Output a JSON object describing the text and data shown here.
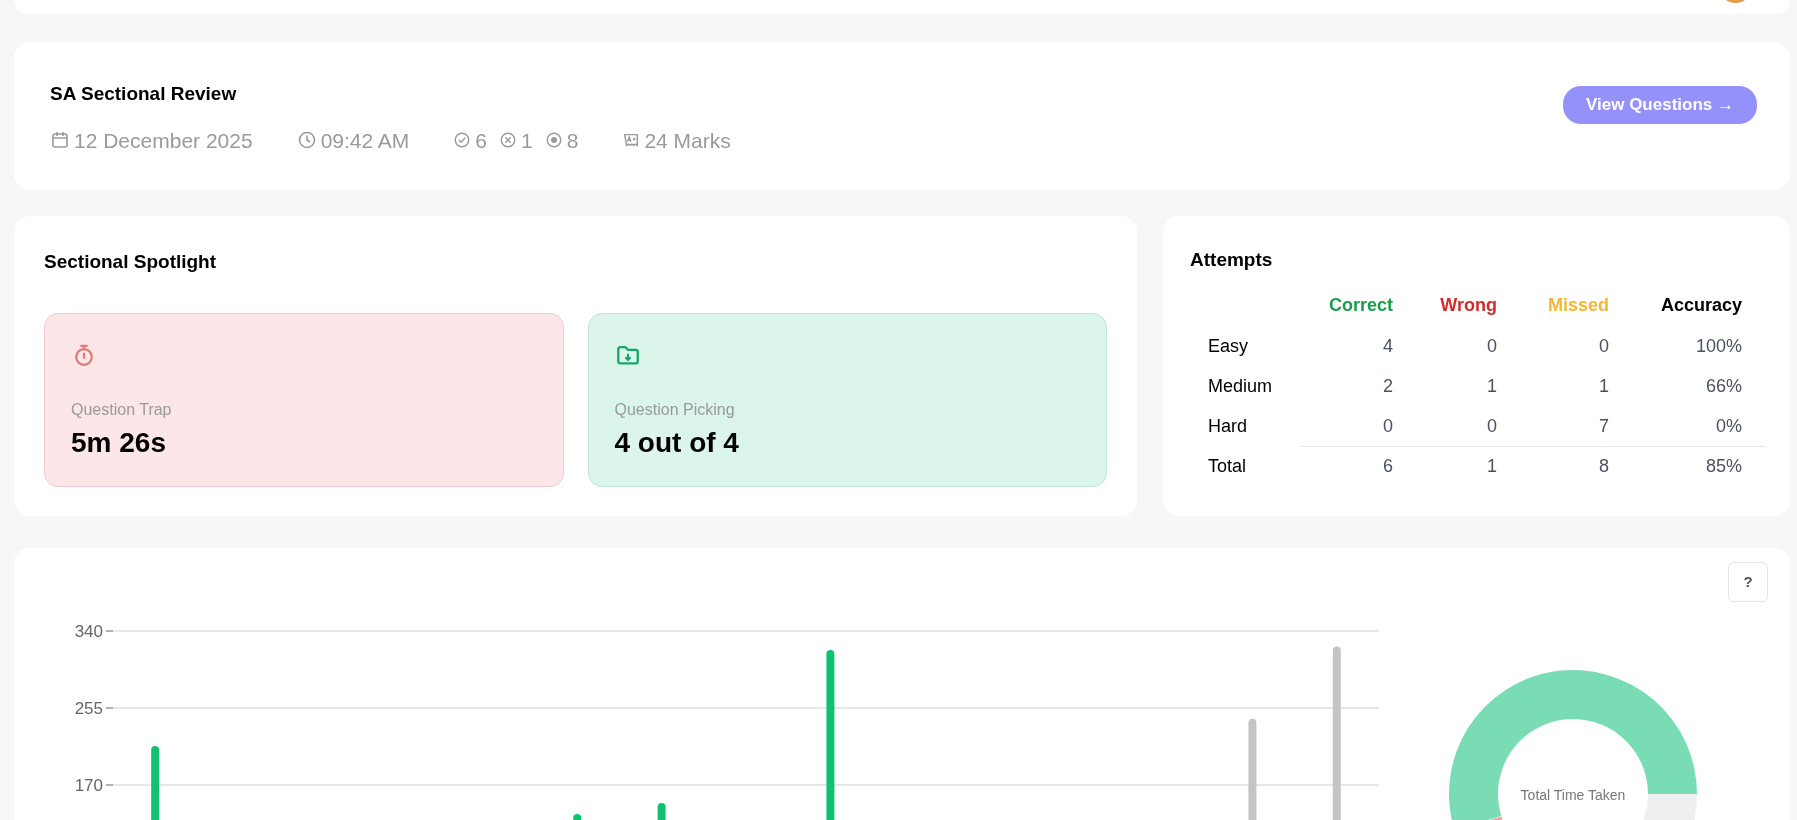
{
  "review": {
    "title": "SA Sectional Review",
    "date": "12 December 2025",
    "time": "09:42 AM",
    "correct": "6",
    "wrong": "1",
    "missed": "8",
    "marks": "24 Marks",
    "button": "View Questions →"
  },
  "spotlight": {
    "title": "Sectional Spotlight",
    "cards": [
      {
        "kind": "trap",
        "label": "Question Trap",
        "value": "5m 26s"
      },
      {
        "kind": "picking",
        "label": "Question Picking",
        "value": "4 out of 4"
      }
    ]
  },
  "attempts": {
    "title": "Attempts",
    "columns": [
      {
        "label": "Correct",
        "color": "#1a9c4b"
      },
      {
        "label": "Wrong",
        "color": "#d42a2a"
      },
      {
        "label": "Missed",
        "color": "#f4b731"
      },
      {
        "label": "Accuracy",
        "color": "#000000"
      }
    ],
    "rows": [
      {
        "kind": "level",
        "label": "Easy",
        "values": [
          "4",
          "0",
          "0",
          "100%"
        ]
      },
      {
        "kind": "level",
        "label": "Medium",
        "values": [
          "2",
          "1",
          "1",
          "66%"
        ]
      },
      {
        "kind": "level",
        "label": "Hard",
        "values": [
          "0",
          "0",
          "7",
          "0%"
        ]
      },
      {
        "kind": "total",
        "label": "Total",
        "values": [
          "6",
          "1",
          "8",
          "85%"
        ]
      }
    ]
  },
  "chart": {
    "help_button": "?",
    "chart_data": {
      "type": "bar",
      "ylim": [
        0,
        340
      ],
      "yticks": [
        170,
        255,
        340
      ],
      "series": [
        {
          "color": "#10c172",
          "values": [
            213,
            null,
            null,
            null,
            null,
            138,
            150,
            null,
            319,
            null,
            null,
            null,
            null,
            null,
            null
          ]
        },
        {
          "color": "#c4c4c4",
          "values": [
            null,
            null,
            null,
            null,
            null,
            null,
            null,
            null,
            null,
            null,
            null,
            null,
            null,
            243,
            323
          ]
        }
      ]
    },
    "donut": {
      "center_label": "Total Time Taken"
    }
  }
}
